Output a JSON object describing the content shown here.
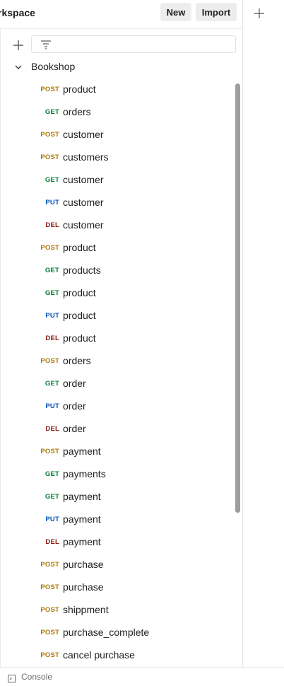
{
  "header": {
    "workspace_title": "rkspace",
    "new_label": "New",
    "import_label": "Import"
  },
  "collection": {
    "name": "Bookshop"
  },
  "method_colors": {
    "POST": "#ad7a03",
    "GET": "#007f31",
    "PUT": "#0053b8",
    "DEL": "#8e1a10"
  },
  "requests": [
    {
      "method": "POST",
      "name": "product"
    },
    {
      "method": "GET",
      "name": "orders"
    },
    {
      "method": "POST",
      "name": "customer"
    },
    {
      "method": "POST",
      "name": "customers"
    },
    {
      "method": "GET",
      "name": "customer"
    },
    {
      "method": "PUT",
      "name": "customer"
    },
    {
      "method": "DEL",
      "name": "customer"
    },
    {
      "method": "POST",
      "name": "product"
    },
    {
      "method": "GET",
      "name": "products"
    },
    {
      "method": "GET",
      "name": "product"
    },
    {
      "method": "PUT",
      "name": "product"
    },
    {
      "method": "DEL",
      "name": "product"
    },
    {
      "method": "POST",
      "name": "orders"
    },
    {
      "method": "GET",
      "name": "order"
    },
    {
      "method": "PUT",
      "name": "order"
    },
    {
      "method": "DEL",
      "name": "order"
    },
    {
      "method": "POST",
      "name": "payment"
    },
    {
      "method": "GET",
      "name": "payments"
    },
    {
      "method": "GET",
      "name": "payment"
    },
    {
      "method": "PUT",
      "name": "payment"
    },
    {
      "method": "DEL",
      "name": "payment"
    },
    {
      "method": "POST",
      "name": "purchase"
    },
    {
      "method": "POST",
      "name": "purchase"
    },
    {
      "method": "POST",
      "name": "shippment"
    },
    {
      "method": "POST",
      "name": "purchase_complete"
    },
    {
      "method": "POST",
      "name": "cancel purchase"
    }
  ],
  "footer": {
    "console_label": "Console"
  }
}
